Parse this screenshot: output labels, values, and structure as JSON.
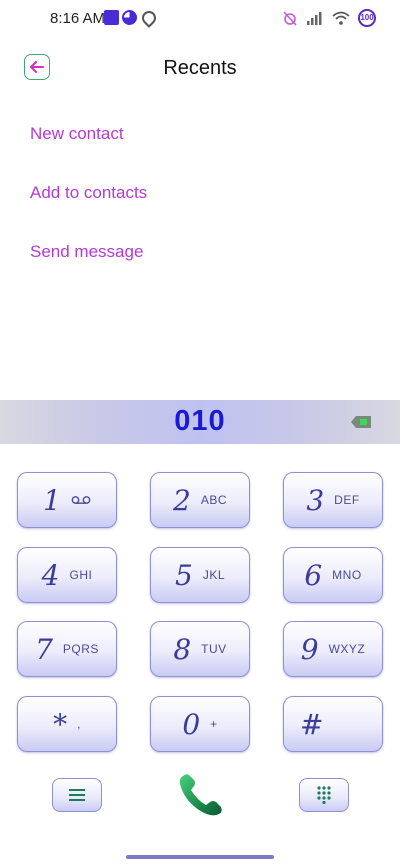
{
  "status_bar": {
    "time": "8:16 AM",
    "battery": "100"
  },
  "header": {
    "title": "Recents"
  },
  "actions": [
    {
      "label": "New contact"
    },
    {
      "label": "Add to contacts"
    },
    {
      "label": "Send message"
    }
  ],
  "dialer": {
    "number": "010",
    "keys": [
      {
        "digit": "1",
        "letters": ""
      },
      {
        "digit": "2",
        "letters": "ABC"
      },
      {
        "digit": "3",
        "letters": "DEF"
      },
      {
        "digit": "4",
        "letters": "GHI"
      },
      {
        "digit": "5",
        "letters": "JKL"
      },
      {
        "digit": "6",
        "letters": "MNO"
      },
      {
        "digit": "7",
        "letters": "PQRS"
      },
      {
        "digit": "8",
        "letters": "TUV"
      },
      {
        "digit": "9",
        "letters": "WXYZ"
      },
      {
        "digit": "*",
        "letters": ","
      },
      {
        "digit": "0",
        "letters": "+"
      },
      {
        "digit": "#",
        "letters": ""
      }
    ]
  },
  "colors": {
    "accent": "#b43ad6",
    "number": "#1a1ad6",
    "call": "#1a8a4a",
    "key_border": "#8f8fd8"
  },
  "icons": {
    "back": "arrow-left-icon",
    "backspace": "backspace-icon",
    "voicemail": "voicemail-icon",
    "call": "phone-icon",
    "menu": "menu-icon",
    "dialpad": "dialpad-icon"
  }
}
